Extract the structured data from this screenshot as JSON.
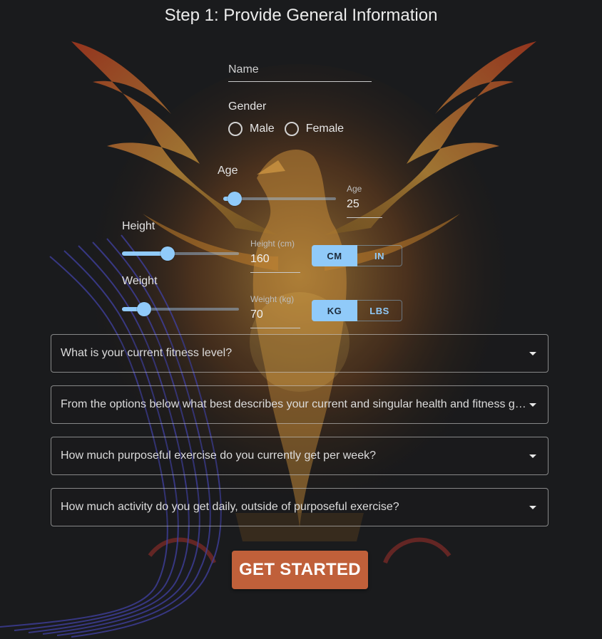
{
  "title": "Step 1: Provide General Information",
  "name_field": {
    "placeholder": "Name",
    "value": ""
  },
  "gender": {
    "label": "Gender",
    "options": [
      "Male",
      "Female"
    ]
  },
  "age": {
    "label": "Age",
    "field_label": "Age",
    "value": "25",
    "slider_level": 0.1
  },
  "height": {
    "label": "Height",
    "field_label": "Height (cm)",
    "value": "160",
    "slider_level": 0.39,
    "units": [
      "CM",
      "IN"
    ],
    "selected_unit": "CM"
  },
  "weight": {
    "label": "Weight",
    "field_label": "Weight (kg)",
    "value": "70",
    "slider_level": 0.19,
    "units": [
      "KG",
      "LBS"
    ],
    "selected_unit": "KG"
  },
  "questions": [
    "What is your current fitness level?",
    "From the options below what best describes your current and singular health and fitness goal?",
    "How much purposeful exercise do you currently get per week?",
    "How much activity do you get daily, outside of purposeful exercise?"
  ],
  "cta_label": "GET STARTED",
  "colors": {
    "background": "#1a1b1d",
    "accent": "#90caf9",
    "cta": "#c0603a"
  }
}
